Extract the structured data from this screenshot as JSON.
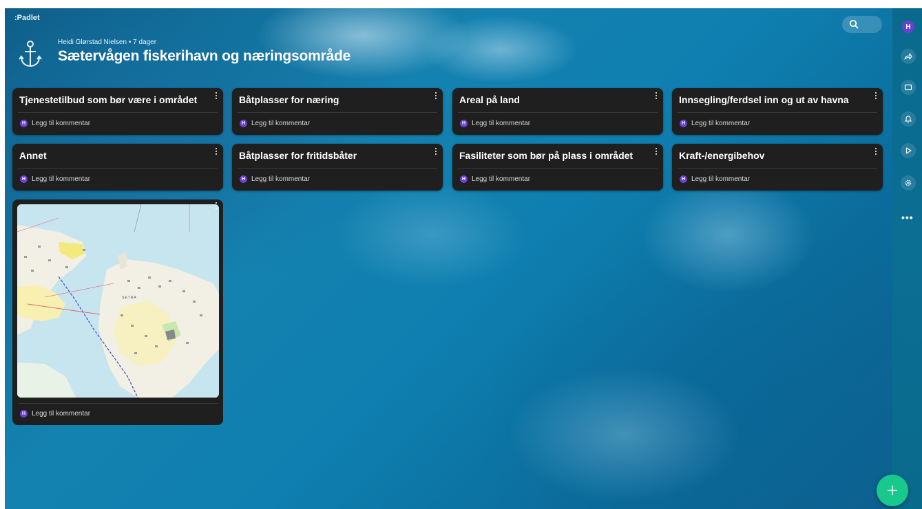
{
  "app": {
    "logo": ":Padlet"
  },
  "header": {
    "author": "Heidi Glørstad Nielsen",
    "age": "7 dager",
    "title": "Sætervågen fiskerihavn og næringsområde"
  },
  "cards": [
    {
      "title": "Tjenestetilbud som bør være i området"
    },
    {
      "title": "Båtplasser for næring"
    },
    {
      "title": "Areal på land"
    },
    {
      "title": "Innsegling/ferdsel inn og ut av havna"
    },
    {
      "title": "Annet"
    },
    {
      "title": "Båtplasser for fritidsbåter"
    },
    {
      "title": "Fasiliteter som bør på plass i området"
    },
    {
      "title": "Kraft-/energibehov"
    }
  ],
  "comment_placeholder": "Legg til kommentar",
  "avatar_initial": "H",
  "map_label": "SETRA",
  "sidebar": {
    "icons": [
      "share-icon",
      "slideshow-icon",
      "bell-icon",
      "play-icon",
      "settings-icon",
      "more-icon"
    ],
    "more": "•••"
  },
  "fab": {
    "label": "+"
  },
  "colors": {
    "card_bg": "#1f1f1f",
    "avatar": "#6b3fd1",
    "fab": "#18c88c",
    "rail": "#0b6e93"
  }
}
